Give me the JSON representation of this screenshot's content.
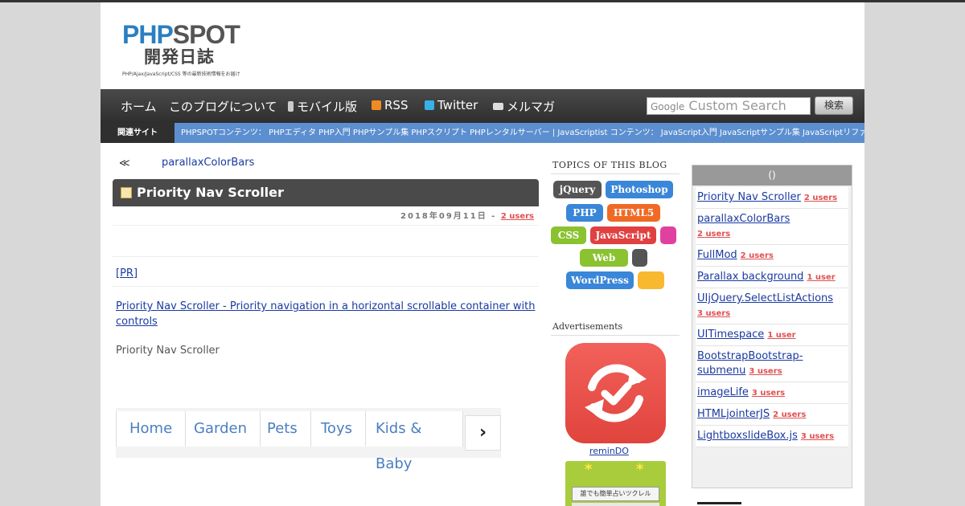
{
  "logo": {
    "main": "PHP",
    "accent": "SPOT",
    "sub": "開発日誌",
    "tagline": "PHP/Ajax/JavaScript/CSS 等の最新技術情報をお届け"
  },
  "nav": {
    "items": [
      {
        "label": "ホーム",
        "icon": ""
      },
      {
        "label": "このブログについて",
        "icon": ""
      },
      {
        "label": "モバイル版",
        "icon": "mobile-icon"
      },
      {
        "label": "RSS",
        "icon": "rss-icon"
      },
      {
        "label": "Twitter",
        "icon": "twitter-icon"
      },
      {
        "label": "メルマガ",
        "icon": "mail-icon"
      }
    ],
    "search_placeholder": "Custom Search",
    "search_brand": "Google",
    "search_button": "検索"
  },
  "related": {
    "label": "関連サイト",
    "text": "PHPSPOTコンテンツ： PHPエディタ   PHP入門   PHPサンプル集   PHPスクリプト   PHPレンタルサーバー   |  JavaScriptist コンテンツ： JavaScript入門   JavaScriptサンプル集   JavaScriptリファレンス"
  },
  "post": {
    "prev_symbol": "≪",
    "prev_link": "parallaxColorBars",
    "title": "Priority Nav Scroller",
    "meta_date": "2018年09月11日 - ",
    "meta_users": "2 users",
    "pr_link": "[PR]",
    "body_link": "Priority Nav Scroller - Priority navigation in a horizontal scrollable container with controls",
    "body_text": "Priority Nav Scroller",
    "demo_items": [
      "Home",
      "Garden",
      "Pets",
      "Toys",
      "Kids & Baby"
    ],
    "demo_next": "›"
  },
  "sidebar": {
    "topics_title": "TOPICS OF THIS BLOG",
    "tags": [
      "jQuery",
      "Photoshop",
      "PHP",
      "HTML5",
      "CSS",
      "JavaScript",
      "",
      "Web",
      "",
      "WordPress",
      ""
    ],
    "ads_title": "Advertisements",
    "app_name": "reminDO",
    "app2_text": "誰でも簡単占いツクレル"
  },
  "ranking": {
    "title": "()",
    "items": [
      {
        "title": "Priority Nav Scroller",
        "users": "2 users"
      },
      {
        "title": "parallaxColorBars",
        "users": "2 users"
      },
      {
        "title": "FullMod",
        "users": "2 users"
      },
      {
        "title": "Parallax background",
        "users": "1 user"
      },
      {
        "title": "UIjQuery.SelectListActions",
        "users": "3 users"
      },
      {
        "title": "UITimespace",
        "users": "1 user"
      },
      {
        "title": "BootstrapBootstrap-submenu",
        "users": "3 users"
      },
      {
        "title": "imageLife",
        "users": "3 users"
      },
      {
        "title": "HTMLjointerJS",
        "users": "2 users"
      },
      {
        "title": "LightboxslideBox.js",
        "users": "3 users"
      }
    ]
  },
  "colors": {
    "tag_jquery": "#555555",
    "tag_photoshop": "#3a86d8",
    "tag_php": "#3a86d8",
    "tag_html5": "#f06a25",
    "tag_css": "#8ac230",
    "tag_javascript": "#e04040",
    "tag_pink": "#e040a0",
    "tag_web": "#8ac230",
    "tag_gray": "#555555",
    "tag_wordpress": "#3a86d8",
    "tag_yellow": "#f8b830"
  }
}
